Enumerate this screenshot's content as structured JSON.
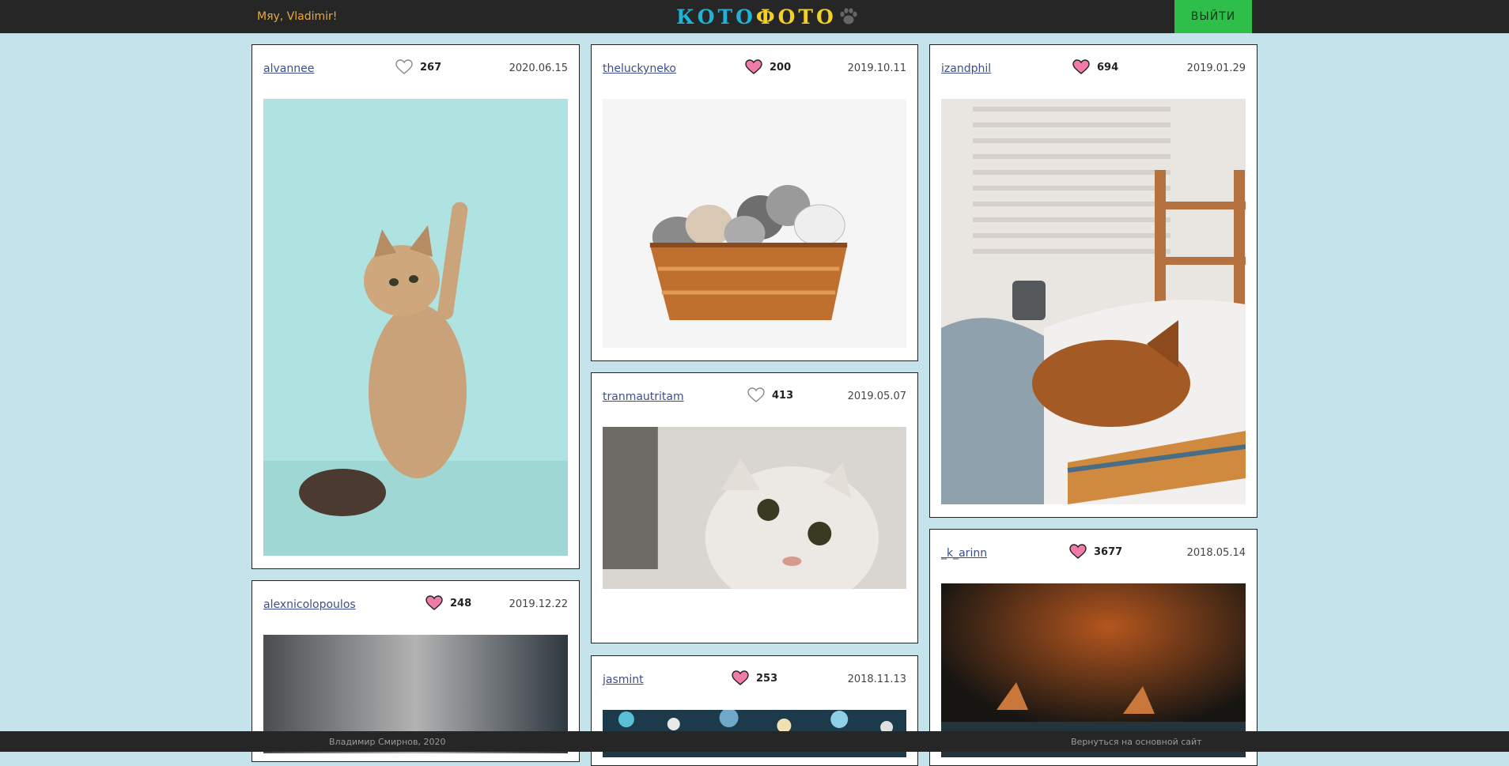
{
  "header": {
    "greeting": "Мяу, Vladimir!",
    "logo": {
      "part1": "КОТО",
      "part2": "ФОТО"
    },
    "logout_label": "ВЫЙТИ"
  },
  "colors": {
    "header_bg": "#262626",
    "page_bg": "#c4e3ea",
    "logout_bg": "#2dbf4a",
    "greeting": "#e8a93c",
    "heart_liked": "#f07aa8"
  },
  "posts": [
    {
      "author": "alvannee",
      "likes": "267",
      "liked": false,
      "date": "2020.06.15",
      "photo": "kitten raising paw on mint background"
    },
    {
      "author": "alexnicolopoulos",
      "likes": "248",
      "liked": true,
      "date": "2019.12.22",
      "photo": "cat on blurred grey background"
    },
    {
      "author": "theluckyneko",
      "likes": "200",
      "liked": true,
      "date": "2019.10.11",
      "photo": "kittens in a wicker basket"
    },
    {
      "author": "tranmautritam",
      "likes": "413",
      "liked": false,
      "date": "2019.05.07",
      "photo": "white fold-eared cat peeking"
    },
    {
      "author": "jasmint",
      "likes": "253",
      "liked": true,
      "date": "2018.11.13",
      "photo": "bokeh lights"
    },
    {
      "author": "izandphil",
      "likes": "694",
      "liked": true,
      "date": "2019.01.29",
      "photo": "tabby cat sleeping on bed by window"
    },
    {
      "author": "_k_arinn",
      "likes": "3677",
      "liked": true,
      "date": "2018.05.14",
      "photo": "cat on dark background"
    }
  ],
  "footer": {
    "copyright": "Владимир Смирнов, 2020",
    "back_link": "Вернуться на основной сайт"
  }
}
